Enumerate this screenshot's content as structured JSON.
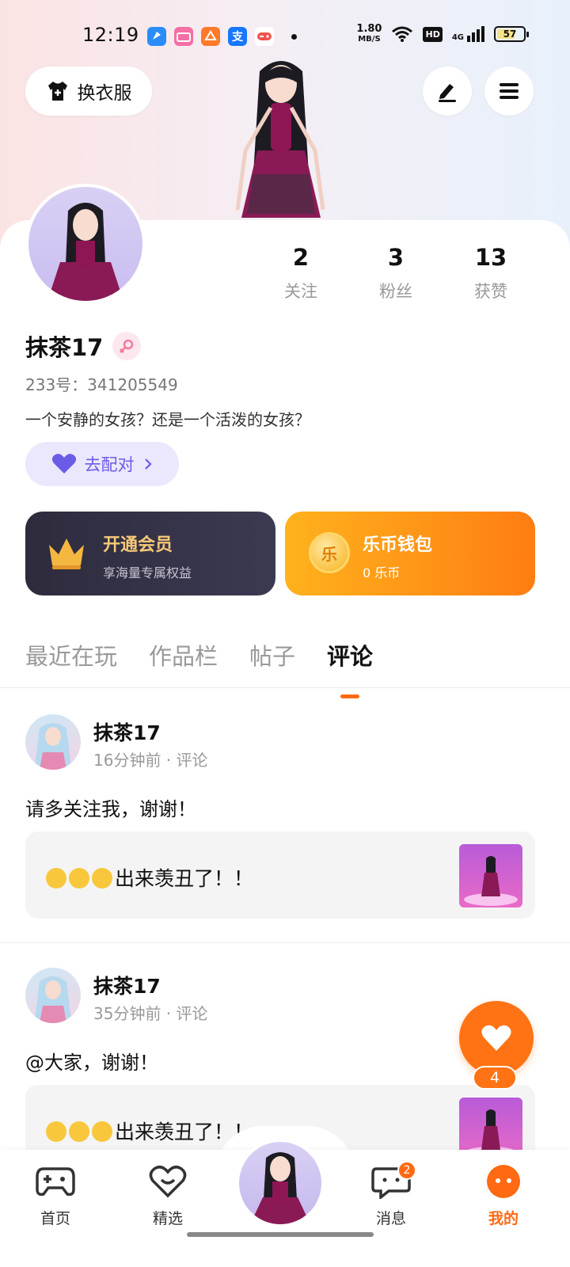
{
  "status_bar": {
    "time": "12:19",
    "speed_value": "1.80",
    "speed_unit": "MB/S",
    "hd": "HD",
    "network": "4G",
    "battery": "57",
    "apps": [
      {
        "icon": "blue-app-icon",
        "color": "#2a8cf7",
        "glyph": ""
      },
      {
        "icon": "bilibili-app-icon",
        "color": "#f46fa6",
        "glyph": ""
      },
      {
        "icon": "orange-app-icon",
        "color": "#ff7a2a",
        "glyph": ""
      },
      {
        "icon": "alipay-app-icon",
        "color": "#1677ff",
        "glyph": "支"
      },
      {
        "icon": "game-app-icon",
        "color": "#f0524f",
        "glyph": ""
      }
    ]
  },
  "header": {
    "dress_label": "换衣服"
  },
  "profile": {
    "name": "抹茶17",
    "uid": "233号：341205549",
    "bio": "一个安静的女孩？还是一个活泼的女孩？",
    "match_label": "去配对",
    "stats": [
      {
        "num": "2",
        "label": "关注"
      },
      {
        "num": "3",
        "label": "粉丝"
      },
      {
        "num": "13",
        "label": "获赞"
      }
    ]
  },
  "cards": {
    "vip_title": "开通会员",
    "vip_sub": "享海量专属权益",
    "wallet_title": "乐币钱包",
    "wallet_sub": "0 乐币",
    "coin_glyph": "乐"
  },
  "tabs": [
    "最近在玩",
    "作品栏",
    "帖子",
    "评论"
  ],
  "active_tab": "评论",
  "posts": [
    {
      "name": "抹茶17",
      "meta": "16分钟前 · 评论",
      "text": "请多关注我，谢谢！",
      "quote": "出来羡丑了！！"
    },
    {
      "name": "抹茶17",
      "meta": "35分钟前 · 评论",
      "text": "@大家，谢谢！",
      "quote": "出来羡丑了！！"
    }
  ],
  "like_count": "4",
  "bottom_nav": {
    "items": [
      {
        "label": "首页"
      },
      {
        "label": "精选"
      },
      {
        "label": "消息",
        "badge": "2"
      },
      {
        "label": "我的"
      }
    ]
  },
  "colors": {
    "accent": "#ff6a13",
    "match": "#6b5ce7",
    "vip_gold": "#f7c978"
  }
}
